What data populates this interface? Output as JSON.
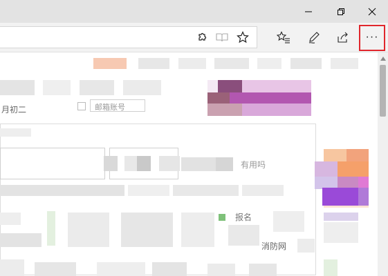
{
  "window": {
    "minimize_icon": "minimize-icon",
    "maximize_icon": "restore-icon",
    "close_icon": "close-icon"
  },
  "toolbar": {
    "icons": [
      "extension-icon",
      "reading-view-icon",
      "favorite-star-icon",
      "favorites-list-icon",
      "pen-icon",
      "share-icon",
      "more-icon"
    ],
    "more_label": "···",
    "highlight_color": "#e0262c"
  },
  "content": {
    "texts": {
      "t1": "月初二",
      "t2": "邮箱账号",
      "t3": "有用吗",
      "t4": "报名",
      "t5": "消防网"
    }
  },
  "colors": {
    "titlebar": "#e3e3e3",
    "toolbar": "#f2f2f2",
    "mosaic_purple": "#9b4aa0",
    "mosaic_orange": "#f5a06a"
  }
}
